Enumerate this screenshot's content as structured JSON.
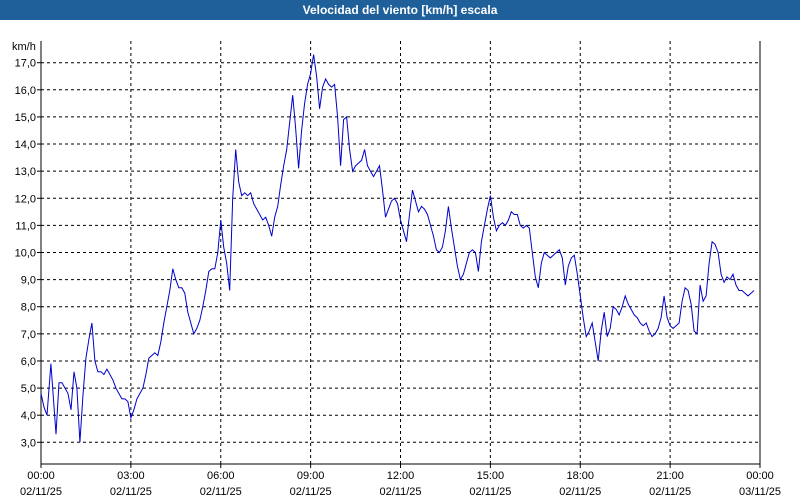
{
  "window": {
    "title": "Velocidad del viento [km/h] escala"
  },
  "chart_data": {
    "type": "line",
    "title": "Velocidad del viento [km/h] escala",
    "ylabel": "km/h",
    "xlabel": "",
    "ylim": [
      2.2,
      17.8
    ],
    "xlim_hours": [
      0,
      24
    ],
    "grid": true,
    "y_ticks": [
      "3,0",
      "4,0",
      "5,0",
      "6,0",
      "7,0",
      "8,0",
      "9,0",
      "10,0",
      "11,0",
      "12,0",
      "13,0",
      "14,0",
      "15,0",
      "16,0",
      "17,0"
    ],
    "x_ticks": [
      {
        "time": "00:00",
        "date": "02/11/25"
      },
      {
        "time": "03:00",
        "date": "02/11/25"
      },
      {
        "time": "06:00",
        "date": "02/11/25"
      },
      {
        "time": "09:00",
        "date": "02/11/25"
      },
      {
        "time": "12:00",
        "date": "02/11/25"
      },
      {
        "time": "15:00",
        "date": "02/11/25"
      },
      {
        "time": "18:00",
        "date": "02/11/25"
      },
      {
        "time": "21:00",
        "date": "02/11/25"
      },
      {
        "time": "00:00",
        "date": "03/11/25"
      }
    ],
    "series": [
      {
        "color": "#0000cc",
        "x_hours": [
          0.0,
          0.1,
          0.2,
          0.33,
          0.5,
          0.6,
          0.7,
          0.9,
          1.0,
          1.1,
          1.2,
          1.3,
          1.4,
          1.5,
          1.6,
          1.7,
          1.8,
          1.9,
          2.0,
          2.1,
          2.2,
          2.3,
          2.4,
          2.5,
          2.6,
          2.7,
          2.8,
          2.9,
          3.0,
          3.1,
          3.2,
          3.3,
          3.4,
          3.5,
          3.6,
          3.7,
          3.8,
          3.9,
          4.0,
          4.1,
          4.2,
          4.3,
          4.4,
          4.5,
          4.6,
          4.7,
          4.8,
          4.9,
          5.0,
          5.1,
          5.2,
          5.3,
          5.4,
          5.5,
          5.6,
          5.7,
          5.8,
          5.9,
          6.0,
          6.1,
          6.2,
          6.3,
          6.4,
          6.5,
          6.6,
          6.7,
          6.8,
          6.9,
          7.0,
          7.1,
          7.2,
          7.3,
          7.4,
          7.5,
          7.6,
          7.7,
          7.8,
          7.9,
          8.0,
          8.1,
          8.2,
          8.3,
          8.4,
          8.5,
          8.6,
          8.7,
          8.8,
          8.9,
          9.0,
          9.1,
          9.2,
          9.3,
          9.4,
          9.5,
          9.6,
          9.7,
          9.8,
          9.9,
          10.0,
          10.1,
          10.2,
          10.3,
          10.4,
          10.5,
          10.6,
          10.7,
          10.8,
          10.9,
          11.0,
          11.1,
          11.2,
          11.3,
          11.4,
          11.5,
          11.6,
          11.7,
          11.8,
          11.9,
          12.0,
          12.1,
          12.2,
          12.3,
          12.4,
          12.5,
          12.6,
          12.7,
          12.8,
          12.9,
          13.0,
          13.1,
          13.2,
          13.3,
          13.4,
          13.5,
          13.6,
          13.7,
          13.8,
          13.9,
          14.0,
          14.1,
          14.2,
          14.3,
          14.4,
          14.5,
          14.6,
          14.7,
          14.8,
          14.9,
          15.0,
          15.1,
          15.2,
          15.3,
          15.4,
          15.5,
          15.6,
          15.7,
          15.8,
          15.9,
          16.0,
          16.1,
          16.2,
          16.3,
          16.4,
          16.5,
          16.6,
          16.7,
          16.8,
          16.9,
          17.0,
          17.1,
          17.2,
          17.3,
          17.4,
          17.5,
          17.6,
          17.7,
          17.8,
          17.9,
          18.0,
          18.1,
          18.2,
          18.3,
          18.4,
          18.5,
          18.6,
          18.7,
          18.8,
          18.9,
          19.0,
          19.1,
          19.2,
          19.3,
          19.4,
          19.5,
          19.6,
          19.7,
          19.8,
          19.9,
          20.0,
          20.1,
          20.2,
          20.3,
          20.4,
          20.5,
          20.6,
          20.7,
          20.8,
          20.9,
          21.0,
          21.1,
          21.2,
          21.3,
          21.4,
          21.5,
          21.6,
          21.7,
          21.8,
          21.9,
          22.0,
          22.1,
          22.2,
          22.3,
          22.4,
          22.5,
          22.6,
          22.7,
          22.8,
          22.9,
          23.0,
          23.1,
          23.2,
          23.3,
          23.4,
          23.5,
          23.6,
          23.7,
          23.8
        ],
        "values": [
          4.8,
          4.3,
          4.0,
          5.9,
          3.3,
          5.2,
          5.2,
          4.8,
          4.2,
          5.6,
          5.0,
          3.0,
          4.7,
          6.1,
          6.8,
          7.4,
          6.0,
          5.6,
          5.6,
          5.5,
          5.7,
          5.5,
          5.3,
          5.0,
          4.8,
          4.6,
          4.6,
          4.5,
          3.9,
          4.2,
          4.6,
          4.8,
          5.0,
          5.5,
          6.1,
          6.2,
          6.3,
          6.2,
          6.7,
          7.4,
          8.0,
          8.6,
          9.4,
          9.0,
          8.7,
          8.7,
          8.5,
          7.8,
          7.4,
          7.0,
          7.2,
          7.5,
          8.0,
          8.6,
          9.3,
          9.4,
          9.4,
          10.0,
          11.2,
          10.2,
          9.6,
          8.6,
          12.0,
          13.8,
          12.6,
          12.1,
          12.2,
          12.1,
          12.2,
          11.8,
          11.6,
          11.4,
          11.2,
          11.3,
          11.0,
          10.6,
          11.3,
          11.7,
          12.5,
          13.2,
          13.8,
          14.8,
          15.8,
          14.6,
          13.1,
          14.5,
          15.5,
          16.2,
          16.6,
          17.3,
          16.5,
          15.3,
          16.1,
          16.4,
          16.2,
          16.1,
          16.2,
          15.0,
          13.2,
          14.9,
          15.0,
          13.8,
          13.0,
          13.2,
          13.3,
          13.4,
          13.8,
          13.2,
          13.0,
          12.8,
          13.0,
          13.2,
          12.3,
          11.3,
          11.6,
          11.9,
          12.0,
          11.8,
          11.2,
          10.8,
          10.4,
          11.4,
          12.3,
          11.9,
          11.5,
          11.7,
          11.6,
          11.4,
          11.0,
          10.6,
          10.1,
          10.0,
          10.2,
          10.8,
          11.7,
          10.9,
          10.2,
          9.5,
          9.0,
          9.2,
          9.6,
          10.0,
          10.1,
          10.0,
          9.3,
          10.4,
          11.0,
          11.6,
          12.1,
          11.3,
          10.8,
          11.0,
          11.1,
          11.0,
          11.2,
          11.5,
          11.4,
          11.4,
          11.0,
          10.9,
          11.0,
          10.9,
          10.0,
          9.1,
          8.7,
          9.6,
          10.0,
          9.9,
          9.8,
          9.9,
          10.0,
          10.1,
          9.8,
          8.8,
          9.5,
          9.8,
          9.9,
          9.2,
          8.4,
          7.6,
          6.9,
          7.1,
          7.4,
          6.7,
          6.0,
          7.1,
          7.8,
          6.9,
          7.2,
          8.0,
          7.9,
          7.7,
          8.0,
          8.4,
          8.1,
          7.9,
          7.7,
          7.6,
          7.4,
          7.3,
          7.4,
          7.1,
          6.9,
          7.0,
          7.2,
          7.6,
          8.4,
          7.6,
          7.3,
          7.2,
          7.3,
          7.4,
          8.2,
          8.7,
          8.6,
          8.1,
          7.1,
          7.0,
          8.8,
          8.2,
          8.4,
          9.6,
          10.4,
          10.3,
          10.0,
          9.2,
          8.9,
          9.1,
          9.0,
          9.2,
          8.8,
          8.6,
          8.6,
          8.5,
          8.4,
          8.5,
          8.6,
          8.5,
          8.4,
          8.3,
          8.0,
          8.2,
          8.1,
          8.1,
          8.5,
          9.2,
          8.8,
          8.4,
          8.7,
          8.9
        ]
      }
    ]
  }
}
